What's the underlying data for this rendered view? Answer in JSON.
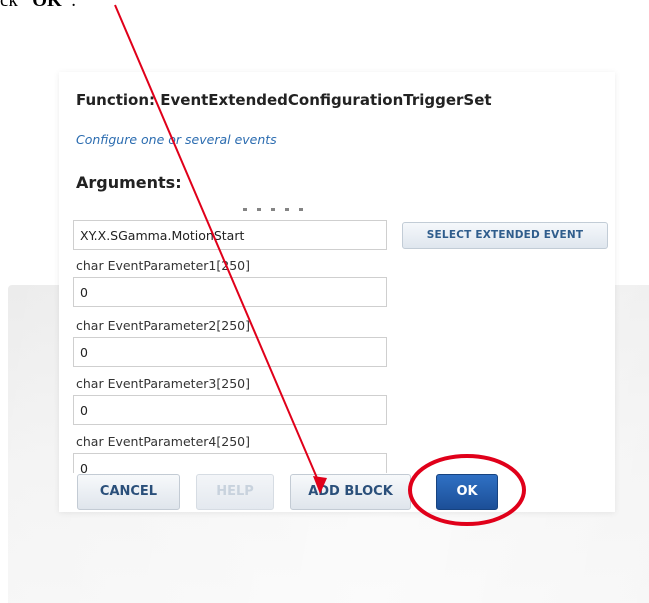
{
  "doc": {
    "prefix": "ck ",
    "bold": "“OK”",
    "suffix": "."
  },
  "dialog": {
    "function_title": "Function: EventExtendedConfigurationTriggerSet",
    "subtitle": "Configure one or several events",
    "arguments_heading": "Arguments:",
    "event_name_value": "XY.X.SGamma.MotionStart",
    "select_extended_event": "SELECT EXTENDED EVENT",
    "params": [
      {
        "label": "char EventParameter1[250]",
        "value": "0"
      },
      {
        "label": "char EventParameter2[250]",
        "value": "0"
      },
      {
        "label": "char EventParameter3[250]",
        "value": "0"
      },
      {
        "label": "char EventParameter4[250]",
        "value": "0"
      }
    ],
    "buttons": {
      "cancel": "CANCEL",
      "help": "HELP",
      "add_block": "ADD BLOCK",
      "ok": "OK"
    }
  },
  "colors": {
    "accent": "#1c4f97",
    "annotation": "#e0001a",
    "link": "#2b6cb0"
  },
  "icons": [
    "arrow-annotation-icon",
    "highlight-circle-icon"
  ]
}
